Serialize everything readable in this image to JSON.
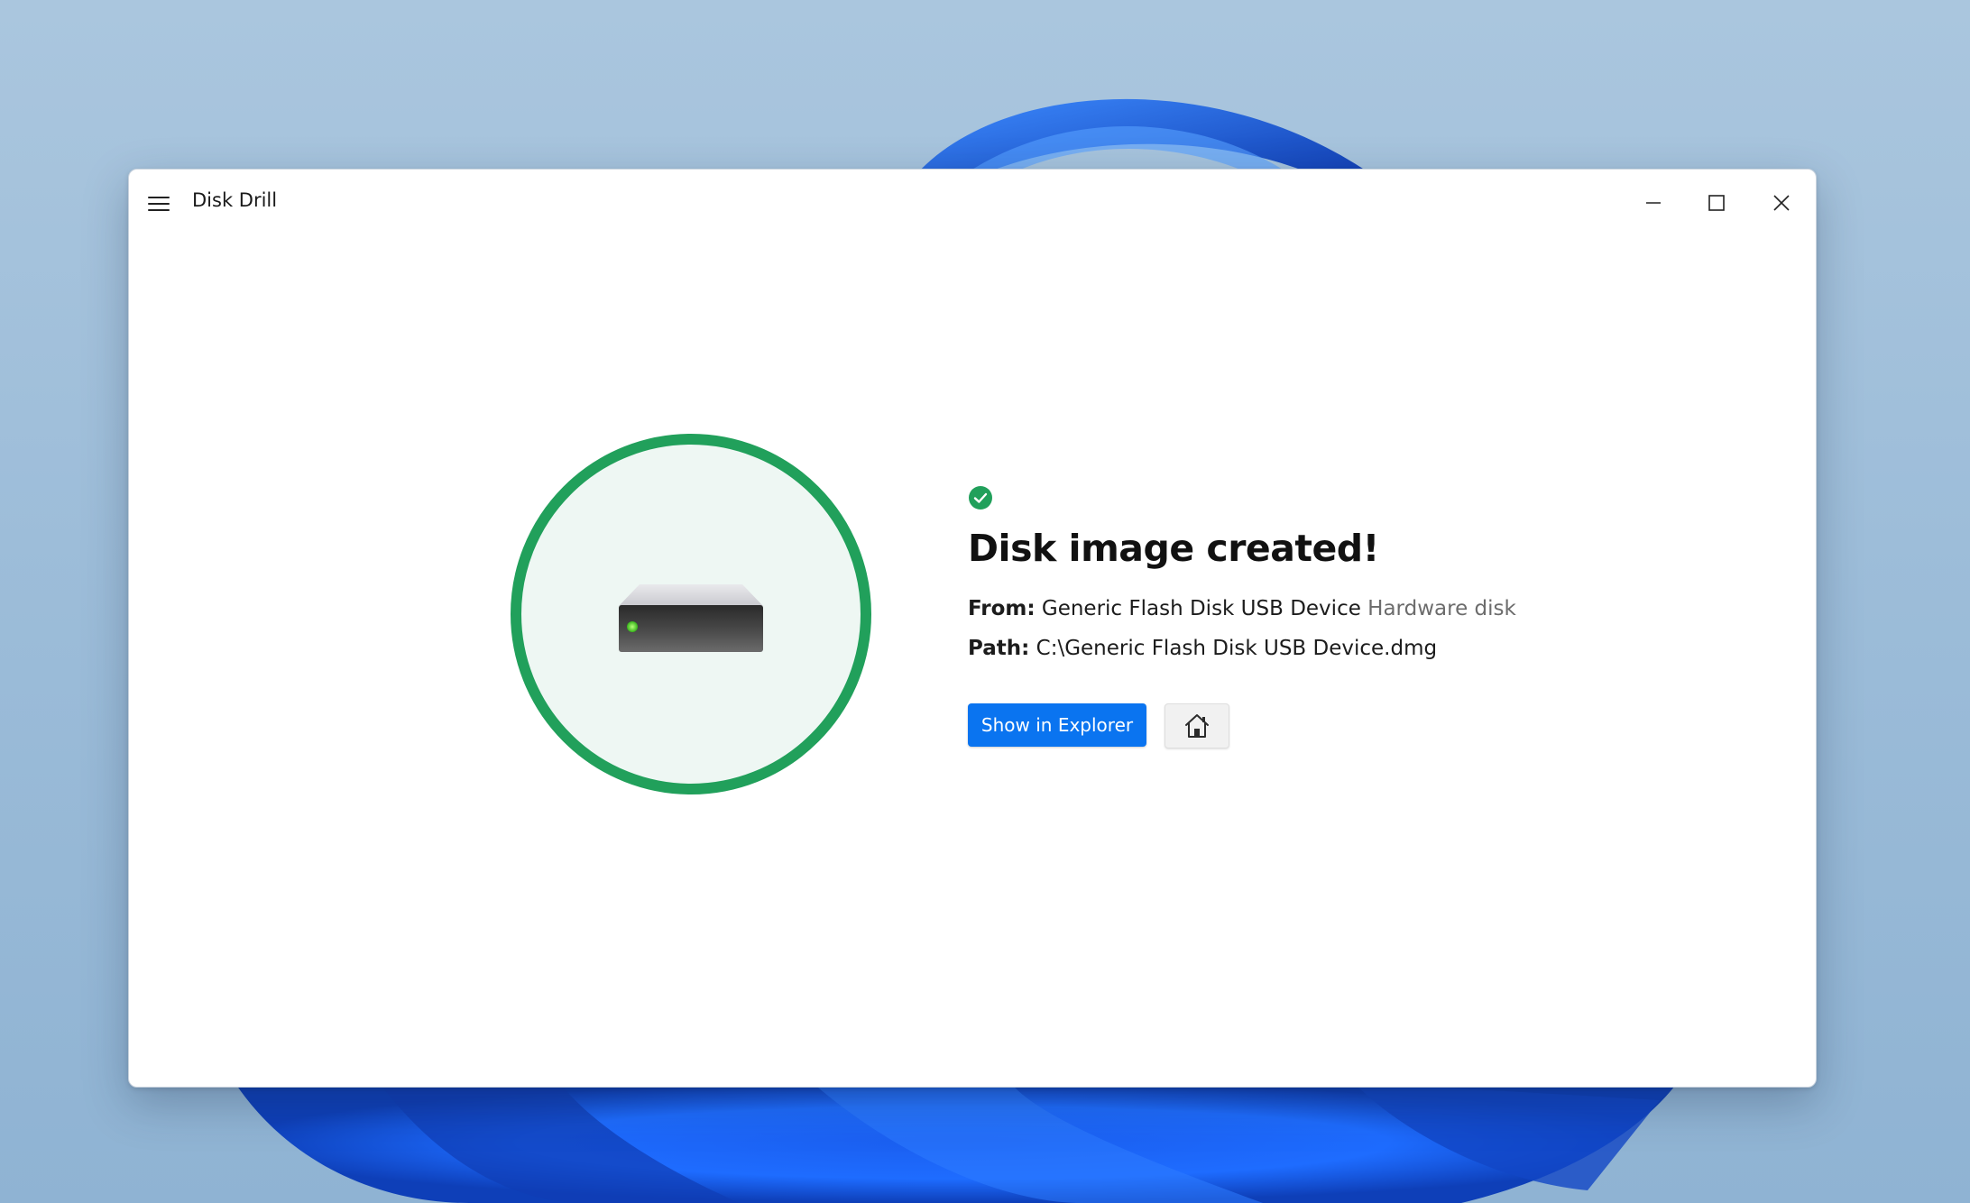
{
  "window": {
    "title": "Disk Drill",
    "icons": {
      "menu": "hamburger-icon",
      "minimize": "minimize-icon",
      "maximize": "maximize-icon",
      "close": "close-icon"
    }
  },
  "result": {
    "status_icon": "check-circle-icon",
    "headline": "Disk image created!",
    "from_label": "From:",
    "from_value": "Generic Flash Disk USB Device",
    "from_type": "Hardware disk",
    "path_label": "Path:",
    "path_value": "C:\\Generic Flash Disk USB Device.dmg",
    "drive_icon": "hard-drive-icon"
  },
  "actions": {
    "show_in_explorer_label": "Show in Explorer",
    "home_icon": "home-icon"
  },
  "colors": {
    "accent": "#0a74f0",
    "success": "#21a05b",
    "circle_fill": "#eef7f3"
  }
}
